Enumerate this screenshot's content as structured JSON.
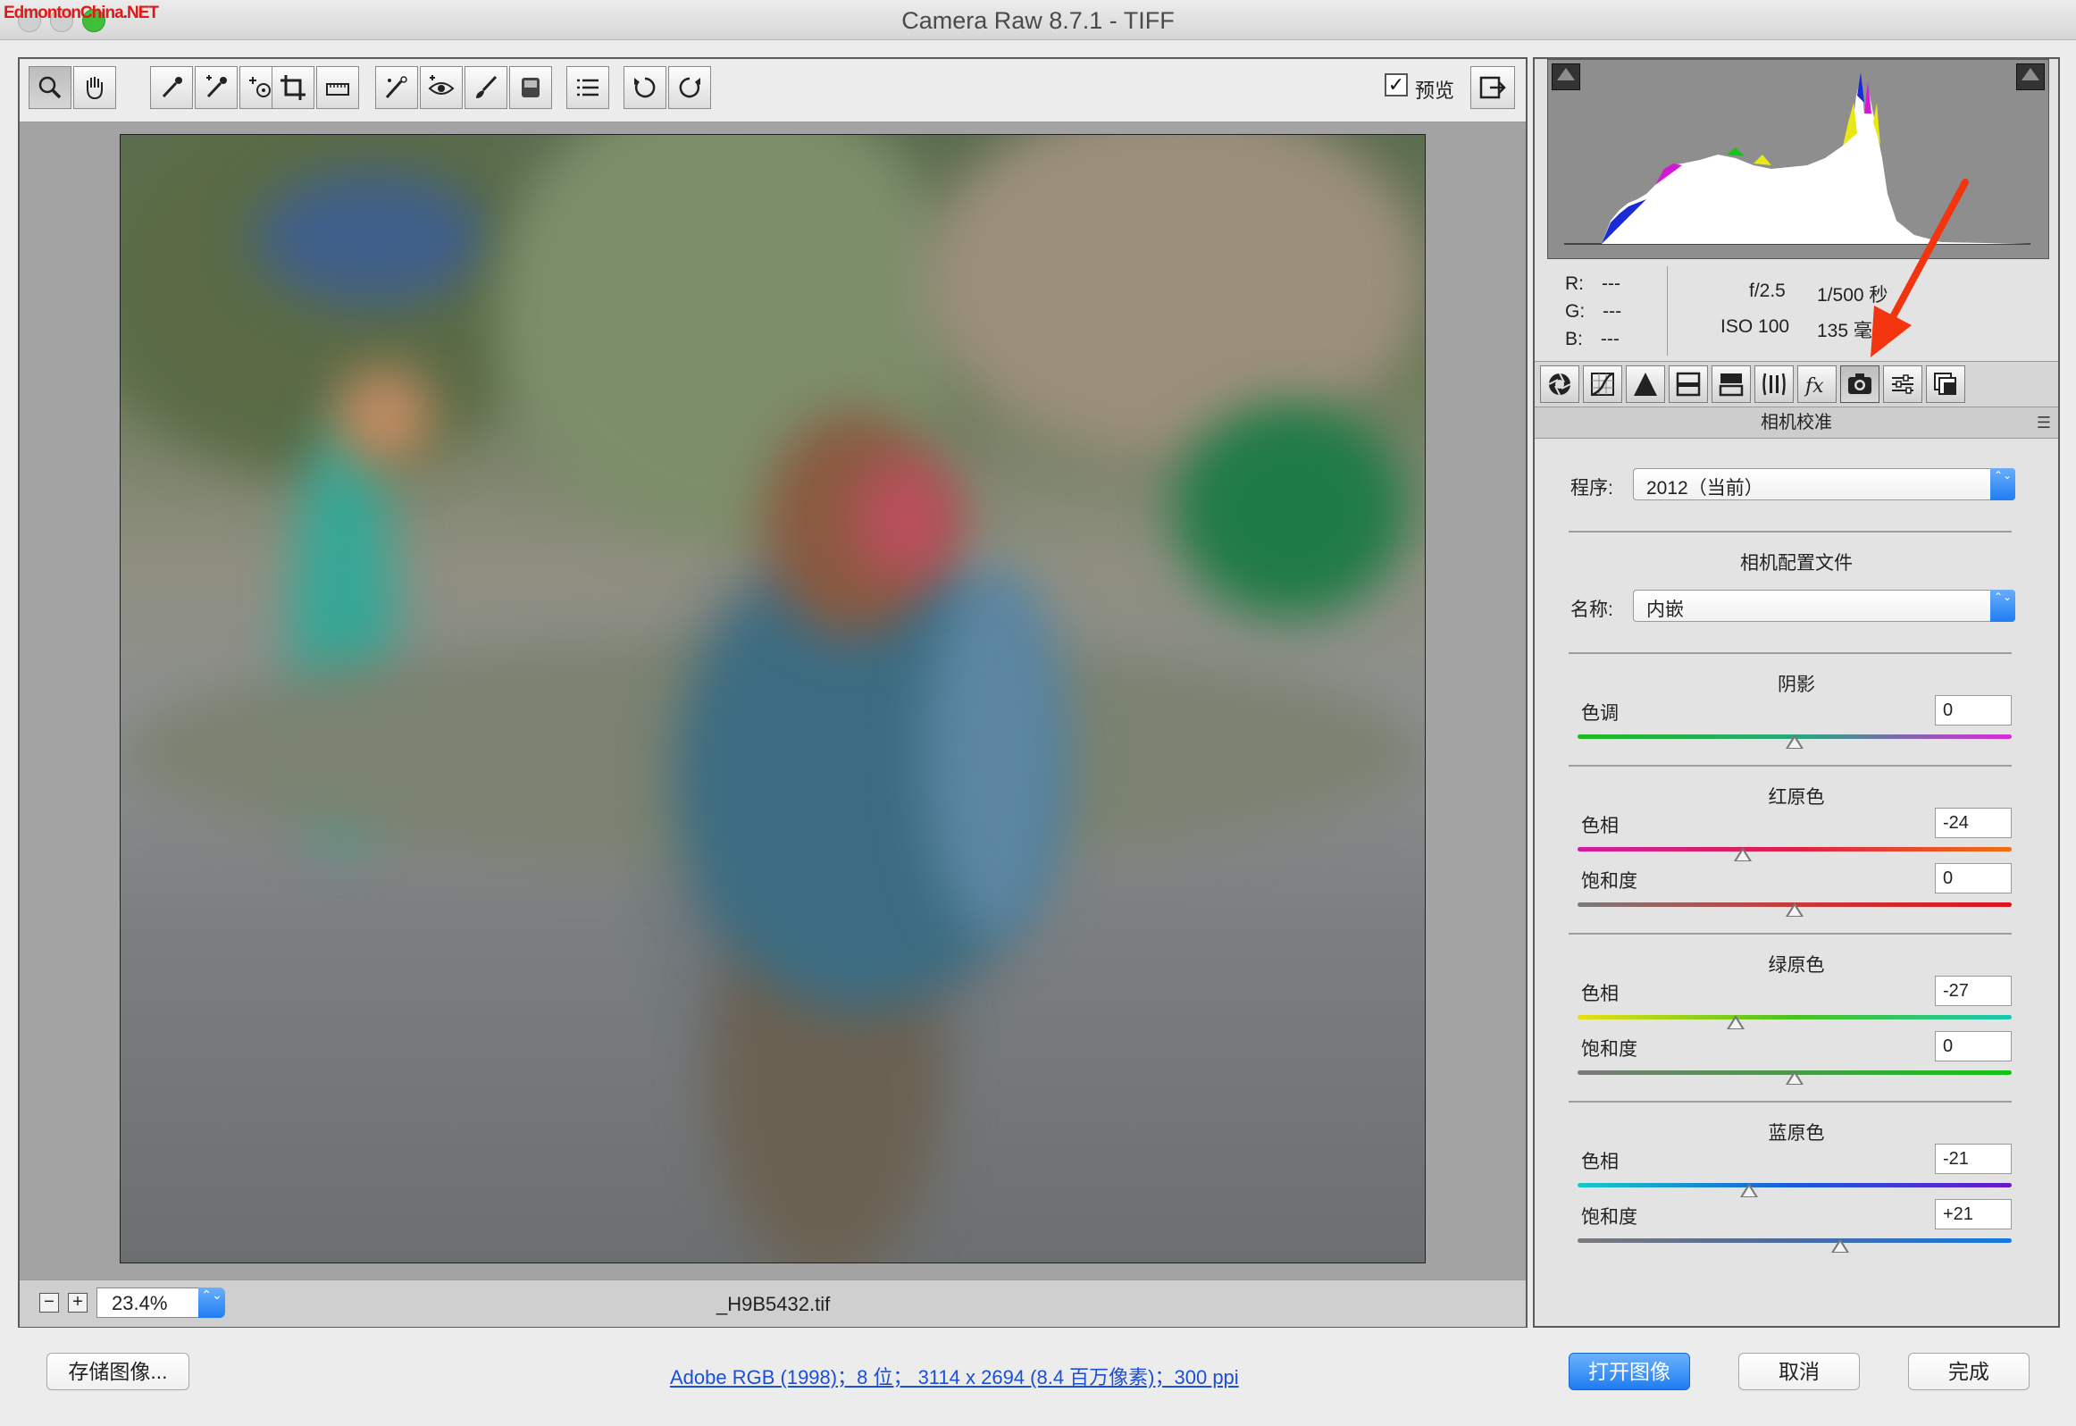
{
  "window": {
    "title": "Camera Raw 8.7.1 -  TIFF",
    "watermark": "EdmontonChina.NET"
  },
  "toolbar": {
    "tools": [
      {
        "name": "zoom-tool-button",
        "icon": "magnifier-icon",
        "active": true
      },
      {
        "name": "hand-tool-button",
        "icon": "hand-icon",
        "active": false
      },
      {
        "name": "white-balance-tool-button",
        "icon": "eyedropper-icon",
        "active": false
      },
      {
        "name": "color-sampler-tool-button",
        "icon": "color-sampler-icon",
        "active": false
      },
      {
        "name": "targeted-adjustment-tool-button",
        "icon": "target-adjust-icon",
        "active": false
      },
      {
        "name": "crop-tool-button",
        "icon": "crop-icon",
        "active": false
      },
      {
        "name": "straighten-tool-button",
        "icon": "straighten-icon",
        "active": false
      },
      {
        "name": "spot-removal-tool-button",
        "icon": "spot-removal-icon",
        "active": false
      },
      {
        "name": "red-eye-tool-button",
        "icon": "red-eye-icon",
        "active": false
      },
      {
        "name": "adjustment-brush-tool-button",
        "icon": "brush-icon",
        "active": false
      },
      {
        "name": "graduated-filter-tool-button",
        "icon": "graduated-filter-icon",
        "active": false
      },
      {
        "name": "preferences-button",
        "icon": "list-icon",
        "active": false
      },
      {
        "name": "rotate-left-button",
        "icon": "rotate-ccw-icon",
        "active": false
      },
      {
        "name": "rotate-right-button",
        "icon": "rotate-cw-icon",
        "active": false
      }
    ],
    "preview_label": "预览",
    "preview_checked": "✓"
  },
  "status": {
    "zoom_minus": "−",
    "zoom_plus": "+",
    "zoom_value": "23.4%",
    "zoom_stepper": "⌃⌄",
    "filename": "_H9B5432.tif"
  },
  "info": {
    "r_label": "R:",
    "r_value": "---",
    "g_label": "G:",
    "g_value": "---",
    "b_label": "B:",
    "b_value": "---",
    "aperture": "f/2.5",
    "shutter": "1/500 秒",
    "iso": "ISO 100",
    "focal": "135 毫米"
  },
  "panel_tabs": [
    {
      "name": "tab-basic",
      "icon": "aperture-icon",
      "active": false
    },
    {
      "name": "tab-tone-curve",
      "icon": "curve-icon",
      "active": false
    },
    {
      "name": "tab-detail",
      "icon": "triangle-icon",
      "active": false
    },
    {
      "name": "tab-hsl",
      "icon": "hsl-icon",
      "active": false
    },
    {
      "name": "tab-split-toning",
      "icon": "split-toning-icon",
      "active": false
    },
    {
      "name": "tab-lens-corrections",
      "icon": "lens-icon",
      "active": false
    },
    {
      "name": "tab-effects",
      "icon": "fx-icon",
      "active": false
    },
    {
      "name": "tab-camera-calibration",
      "icon": "camera-icon",
      "active": true
    },
    {
      "name": "tab-presets",
      "icon": "sliders-icon",
      "active": false
    },
    {
      "name": "tab-snapshots",
      "icon": "snapshot-icon",
      "active": false
    }
  ],
  "panel": {
    "title": "相机校准",
    "menu_icon": "panel-menu-icon",
    "menu_glyph": "☰",
    "process_label": "程序:",
    "process_value": "2012（当前）",
    "stepper_glyph": "⌃⌄",
    "profile_section": "相机配置文件",
    "name_label": "名称:",
    "name_value": "内嵌",
    "shadows": {
      "title": "阴影",
      "tint_label": "色调",
      "tint_value": "0",
      "tint_min": -100,
      "tint_max": 100
    },
    "red": {
      "title": "红原色",
      "hue_label": "色相",
      "hue_value": "-24",
      "sat_label": "饱和度",
      "sat_value": "0"
    },
    "green": {
      "title": "绿原色",
      "hue_label": "色相",
      "hue_value": "-27",
      "sat_label": "饱和度",
      "sat_value": "0"
    },
    "blue": {
      "title": "蓝原色",
      "hue_label": "色相",
      "hue_value": "-21",
      "sat_label": "饱和度",
      "sat_value": "+21"
    },
    "slider_fraction": {
      "shadow_tint": 0.5,
      "red_hue": 0.38,
      "red_sat": 0.5,
      "green_hue": 0.365,
      "green_sat": 0.5,
      "blue_hue": 0.395,
      "blue_sat": 0.605
    }
  },
  "bottom": {
    "save_label": "存储图像...",
    "workflow_label": "Adobe RGB (1998)；8 位； 3114 x 2694 (8.4 百万像素)；300 ppi",
    "open_label": "打开图像",
    "cancel_label": "取消",
    "done_label": "完成"
  },
  "colors": {
    "accent_blue": "#1f7ef2",
    "annotation_arrow": "#f2350f"
  }
}
